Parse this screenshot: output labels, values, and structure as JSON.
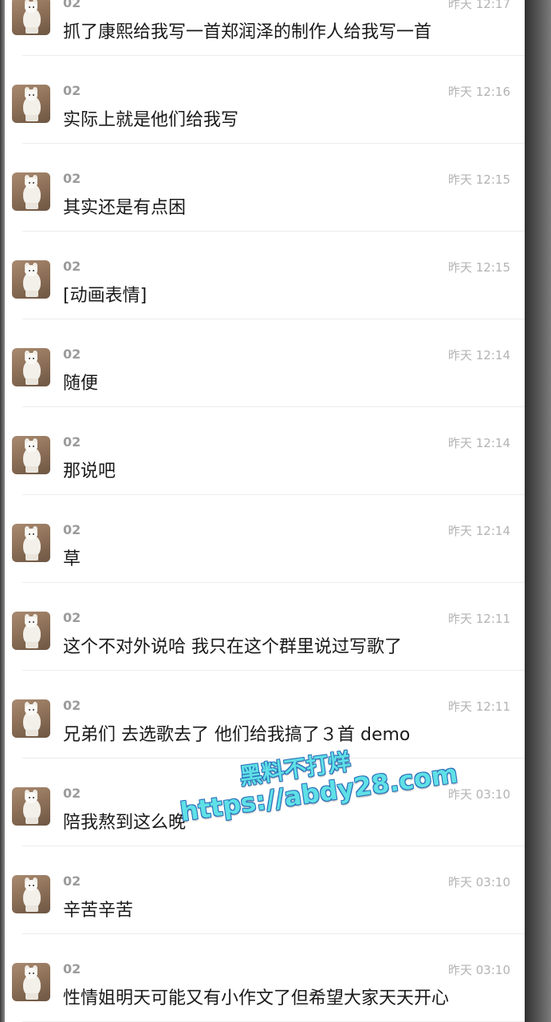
{
  "messages": [
    {
      "name": "02",
      "time": "昨天 12:17",
      "text": "抓了康熙给我写一首郑润泽的制作人给我写一首"
    },
    {
      "name": "02",
      "time": "昨天 12:16",
      "text": "实际上就是他们给我写"
    },
    {
      "name": "02",
      "time": "昨天 12:15",
      "text": "其实还是有点困"
    },
    {
      "name": "02",
      "time": "昨天 12:15",
      "text": "[动画表情]"
    },
    {
      "name": "02",
      "time": "昨天 12:14",
      "text": "随便"
    },
    {
      "name": "02",
      "time": "昨天 12:14",
      "text": "那说吧"
    },
    {
      "name": "02",
      "time": "昨天 12:14",
      "text": "草"
    },
    {
      "name": "02",
      "time": "昨天 12:11",
      "text": "这个不对外说哈 我只在这个群里说过写歌了"
    },
    {
      "name": "02",
      "time": "昨天 12:11",
      "text": "兄弟们 去选歌去了 他们给我搞了３首 demo"
    },
    {
      "name": "02",
      "time": "昨天 03:10",
      "text": "陪我熬到这么晚"
    },
    {
      "name": "02",
      "time": "昨天 03:10",
      "text": "辛苦辛苦"
    },
    {
      "name": "02",
      "time": "昨天 03:10",
      "text": "性情姐明天可能又有小作文了但希望大家天天开心"
    }
  ],
  "watermark": {
    "line1": "黑料不打烊",
    "line2": "https://abdy28.com"
  },
  "avatar_icon": "white-dog-avatar"
}
